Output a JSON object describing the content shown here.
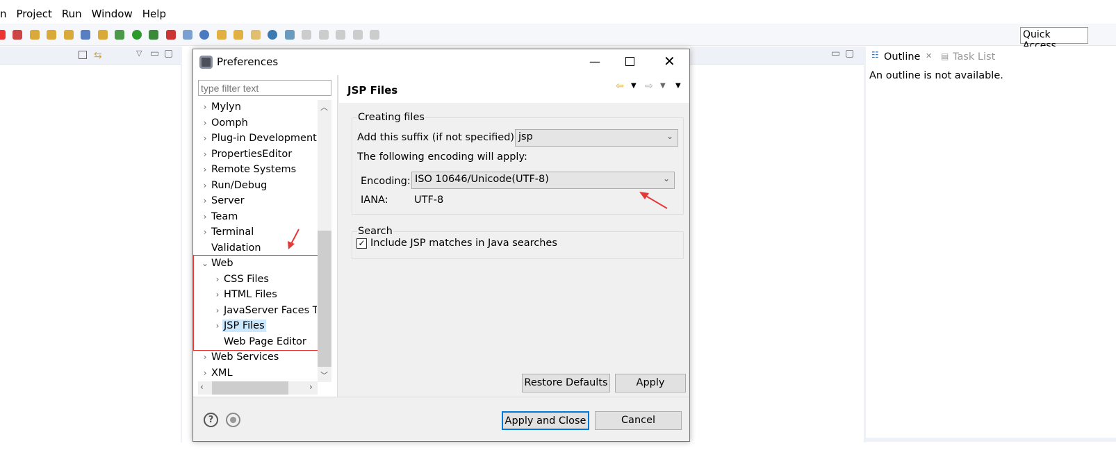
{
  "menu": [
    "n",
    "Project",
    "Run",
    "Window",
    "Help"
  ],
  "quick_access": "Quick Access",
  "outline": {
    "tab": "Outline",
    "tab2": "Task List",
    "message": "An outline is not available."
  },
  "dialog": {
    "title": "Preferences",
    "filter_placeholder": "type filter text",
    "tree": [
      {
        "label": "Mylyn",
        "level": 0,
        "chev": "›"
      },
      {
        "label": "Oomph",
        "level": 0,
        "chev": "›"
      },
      {
        "label": "Plug-in Development",
        "level": 0,
        "chev": "›"
      },
      {
        "label": "PropertiesEditor",
        "level": 0,
        "chev": "›"
      },
      {
        "label": "Remote Systems",
        "level": 0,
        "chev": "›"
      },
      {
        "label": "Run/Debug",
        "level": 0,
        "chev": "›"
      },
      {
        "label": "Server",
        "level": 0,
        "chev": "›"
      },
      {
        "label": "Team",
        "level": 0,
        "chev": "›"
      },
      {
        "label": "Terminal",
        "level": 0,
        "chev": "›"
      },
      {
        "label": "Validation",
        "level": 0,
        "chev": ""
      },
      {
        "label": "Web",
        "level": 0,
        "chev": "⌄"
      },
      {
        "label": "CSS Files",
        "level": 1,
        "chev": "›"
      },
      {
        "label": "HTML Files",
        "level": 1,
        "chev": "›"
      },
      {
        "label": "JavaServer Faces T",
        "level": 1,
        "chev": "›"
      },
      {
        "label": "JSP Files",
        "level": 1,
        "chev": "›",
        "selected": true
      },
      {
        "label": "Web Page Editor",
        "level": 1,
        "chev": ""
      },
      {
        "label": "Web Services",
        "level": 0,
        "chev": "›"
      },
      {
        "label": "XML",
        "level": 0,
        "chev": "›"
      }
    ],
    "page_title": "JSP Files",
    "creating_group": "Creating files",
    "suffix_label": "Add this suffix (if not specified):",
    "suffix_value": "jsp",
    "encoding_note": "The following encoding will apply:",
    "encoding_label": "Encoding:",
    "encoding_value": "ISO 10646/Unicode(UTF-8)",
    "iana_label": "IANA:",
    "iana_value": "UTF-8",
    "search_group": "Search",
    "include_jsp": "Include JSP matches in Java searches",
    "include_jsp_checked": true,
    "restore_defaults": "Restore Defaults",
    "apply": "Apply",
    "apply_close": "Apply and Close",
    "cancel": "Cancel"
  },
  "colors": {
    "annotation": "#e53935",
    "selection": "#cce8ff",
    "accent": "#0078d7"
  }
}
